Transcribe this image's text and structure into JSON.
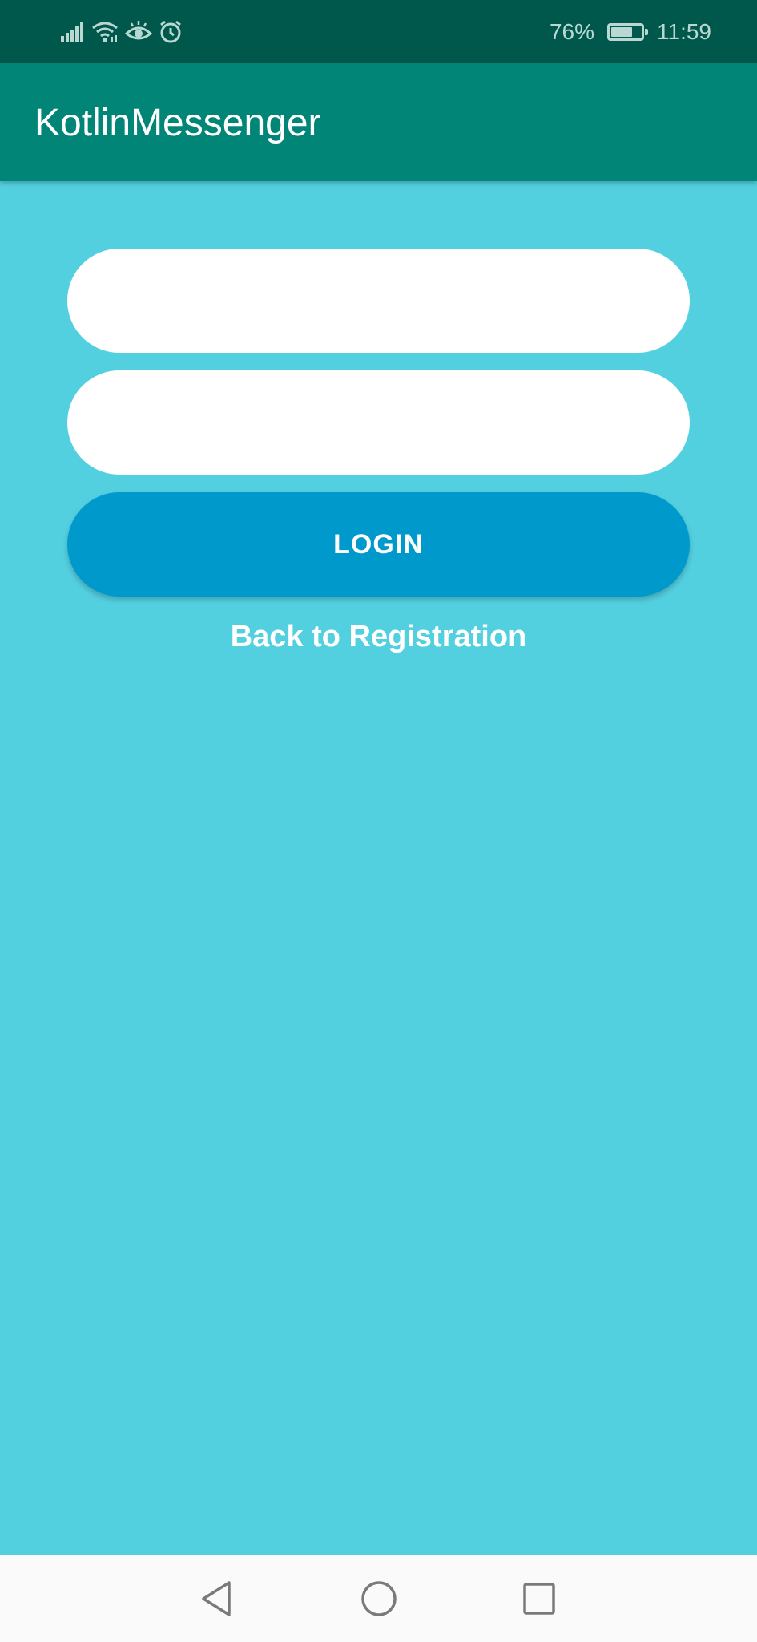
{
  "status_bar": {
    "battery_percent_label": "76%",
    "battery_level": 0.76,
    "time": "11:59",
    "icons": [
      "signal-icon",
      "wifi-icon",
      "eye-comfort-icon",
      "alarm-icon",
      "battery-icon"
    ]
  },
  "app_bar": {
    "title": "KotlinMessenger"
  },
  "login_form": {
    "email": {
      "value": "",
      "placeholder": ""
    },
    "password": {
      "value": "",
      "placeholder": ""
    },
    "login_label": "LOGIN",
    "back_link_label": "Back to Registration"
  },
  "navigation_bar": {
    "icons": [
      "back-icon",
      "home-icon",
      "recents-icon"
    ]
  },
  "colors": {
    "status_bar": "#00574b",
    "app_bar": "#008577",
    "background": "#53d0e0",
    "login_button": "#0099cc",
    "field": "#ffffff",
    "nav_bar": "#fafafa"
  }
}
